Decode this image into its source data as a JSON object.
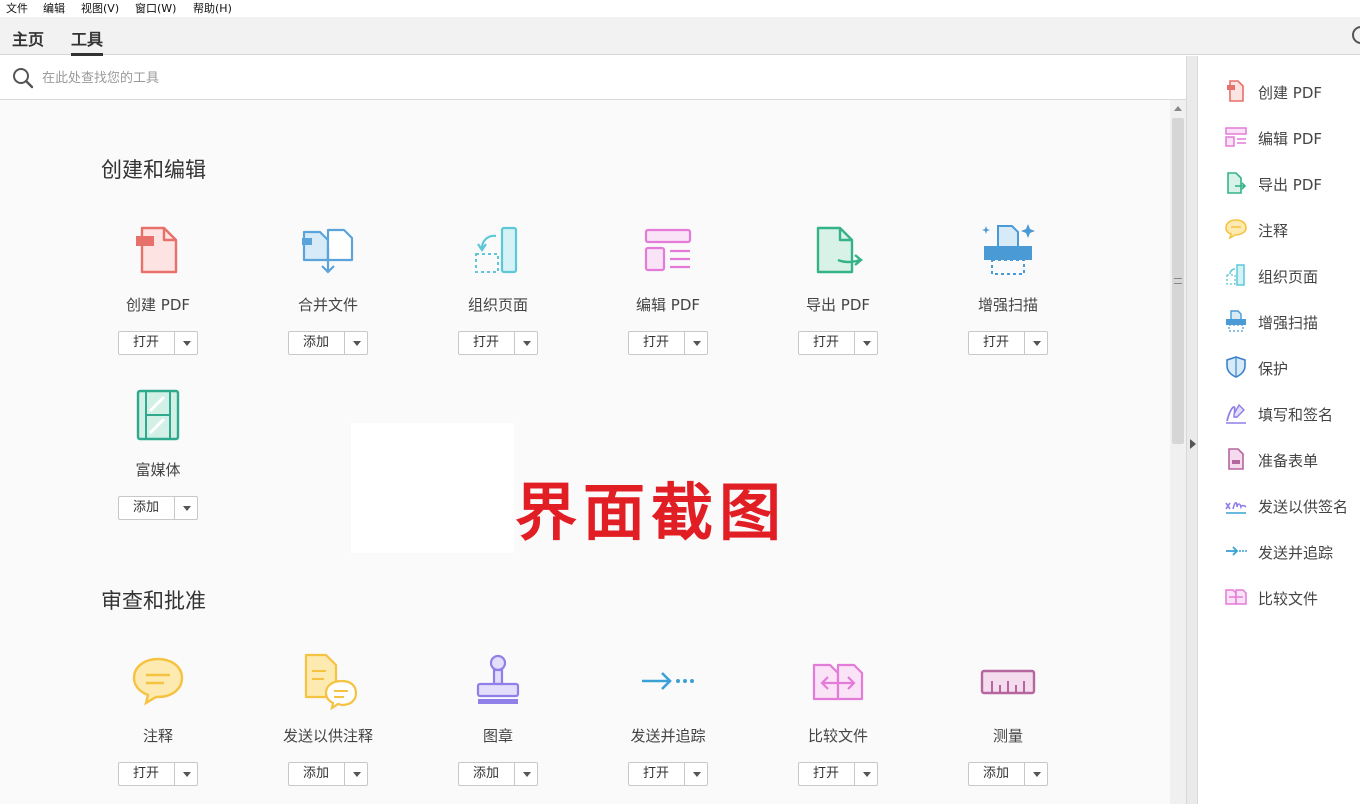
{
  "menubar": {
    "items": [
      "文件",
      "编辑",
      "视图(V)",
      "窗口(W)",
      "帮助(H)"
    ]
  },
  "tabs": {
    "home": "主页",
    "tools": "工具"
  },
  "search": {
    "placeholder": "在此处查找您的工具"
  },
  "sections": {
    "create_edit": "创建和编辑",
    "review": "审查和批准"
  },
  "tools": [
    {
      "label": "创建 PDF",
      "button": "打开",
      "icon": "create-pdf-icon",
      "color": "#e8706a"
    },
    {
      "label": "合并文件",
      "button": "添加",
      "icon": "combine-files-icon",
      "color": "#5aa3db"
    },
    {
      "label": "组织页面",
      "button": "打开",
      "icon": "organize-pages-icon",
      "color": "#5cc8d8"
    },
    {
      "label": "编辑 PDF",
      "button": "打开",
      "icon": "edit-pdf-icon",
      "color": "#e37bd8"
    },
    {
      "label": "导出 PDF",
      "button": "打开",
      "icon": "export-pdf-icon",
      "color": "#34b38a"
    },
    {
      "label": "增强扫描",
      "button": "打开",
      "icon": "enhance-scan-icon",
      "color": "#4a9ad6"
    },
    {
      "label": "富媒体",
      "button": "添加",
      "icon": "rich-media-icon",
      "color": "#2fa98c"
    },
    {
      "label": "注释",
      "button": "打开",
      "icon": "comment-icon",
      "color": "#f5c242"
    },
    {
      "label": "发送以供注释",
      "button": "添加",
      "icon": "send-for-comments-icon",
      "color": "#f5c242"
    },
    {
      "label": "图章",
      "button": "添加",
      "icon": "stamp-icon",
      "color": "#8f7fe8"
    },
    {
      "label": "发送并追踪",
      "button": "打开",
      "icon": "send-and-track-icon",
      "color": "#3aa0d6"
    },
    {
      "label": "比较文件",
      "button": "打开",
      "icon": "compare-files-icon",
      "color": "#e37bd8"
    },
    {
      "label": "测量",
      "button": "添加",
      "icon": "measure-icon",
      "color": "#b5669e"
    }
  ],
  "watermark": "界面截图",
  "right_panel": [
    {
      "label": "创建 PDF",
      "icon": "create-pdf-icon"
    },
    {
      "label": "编辑 PDF",
      "icon": "edit-pdf-icon"
    },
    {
      "label": "导出 PDF",
      "icon": "export-pdf-icon"
    },
    {
      "label": "注释",
      "icon": "comment-icon"
    },
    {
      "label": "组织页面",
      "icon": "organize-pages-icon"
    },
    {
      "label": "增强扫描",
      "icon": "enhance-scan-icon"
    },
    {
      "label": "保护",
      "icon": "protect-icon"
    },
    {
      "label": "填写和签名",
      "icon": "fill-sign-icon"
    },
    {
      "label": "准备表单",
      "icon": "prepare-form-icon"
    },
    {
      "label": "发送以供签名",
      "icon": "send-for-signature-icon"
    },
    {
      "label": "发送并追踪",
      "icon": "send-and-track-icon"
    },
    {
      "label": "比较文件",
      "icon": "compare-files-icon"
    }
  ]
}
